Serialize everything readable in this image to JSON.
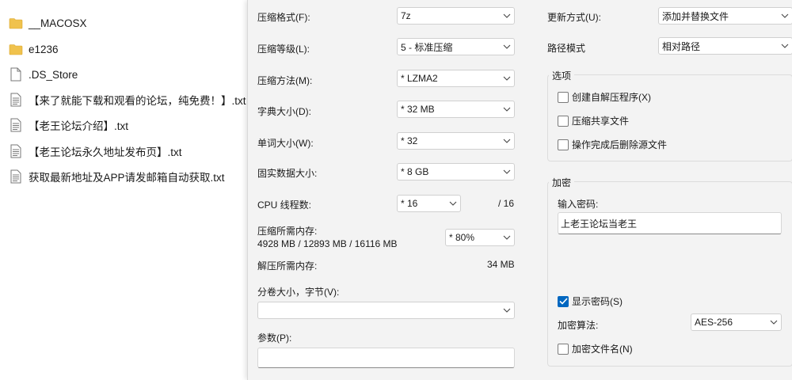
{
  "files": [
    {
      "name": "__MACOSX",
      "icon": "folder-icon"
    },
    {
      "name": "e1236",
      "icon": "folder-icon"
    },
    {
      "name": ".DS_Store",
      "icon": "file-icon"
    },
    {
      "name": "【来了就能下载和观看的论坛，纯免费！】.txt",
      "icon": "text-file-icon"
    },
    {
      "name": "【老王论坛介绍】.txt",
      "icon": "text-file-icon"
    },
    {
      "name": "【老王论坛永久地址发布页】.txt",
      "icon": "text-file-icon"
    },
    {
      "name": "获取最新地址及APP请发邮箱自动获取.txt",
      "icon": "text-file-icon"
    }
  ],
  "settings": {
    "format": {
      "label": "压缩格式(F):",
      "value": "7z"
    },
    "level": {
      "label": "压缩等级(L):",
      "value": "5 - 标准压缩"
    },
    "method": {
      "label": "压缩方法(M):",
      "value": "*  LZMA2"
    },
    "dict": {
      "label": "字典大小(D):",
      "value": "*  32 MB"
    },
    "word": {
      "label": "单词大小(W):",
      "value": "*  32"
    },
    "solid": {
      "label": "固实数据大小:",
      "value": "*  8 GB"
    },
    "threads": {
      "label": "CPU 线程数:",
      "value": "*  16",
      "max": "/ 16"
    },
    "mem_compress": {
      "label": "压缩所需内存:",
      "detail": "4928 MB / 12893 MB / 16116 MB",
      "value": "*  80%"
    },
    "mem_decompress": {
      "label": "解压所需内存:",
      "value": "34 MB"
    },
    "volume": {
      "label": "分卷大小，字节(V):",
      "value": ""
    },
    "params": {
      "label": "参数(P):",
      "value": ""
    }
  },
  "update": {
    "label": "更新方式(U):",
    "value": "添加并替换文件"
  },
  "path": {
    "label": "路径模式",
    "value": "相对路径"
  },
  "options": {
    "title": "选项",
    "items": [
      {
        "label": "创建自解压程序(X)",
        "checked": false
      },
      {
        "label": "压缩共享文件",
        "checked": false
      },
      {
        "label": "操作完成后删除源文件",
        "checked": false
      }
    ]
  },
  "encryption": {
    "title": "加密",
    "password_label": "输入密码:",
    "password_value": "上老王论坛当老王",
    "show_password": {
      "label": "显示密码(S)",
      "checked": true
    },
    "algorithm_label": "加密算法:",
    "algorithm_value": "AES-256",
    "encrypt_names": {
      "label": "加密文件名(N)",
      "checked": false
    }
  },
  "colors": {
    "accent": "#0067c0",
    "folder": "#f0c24d"
  }
}
